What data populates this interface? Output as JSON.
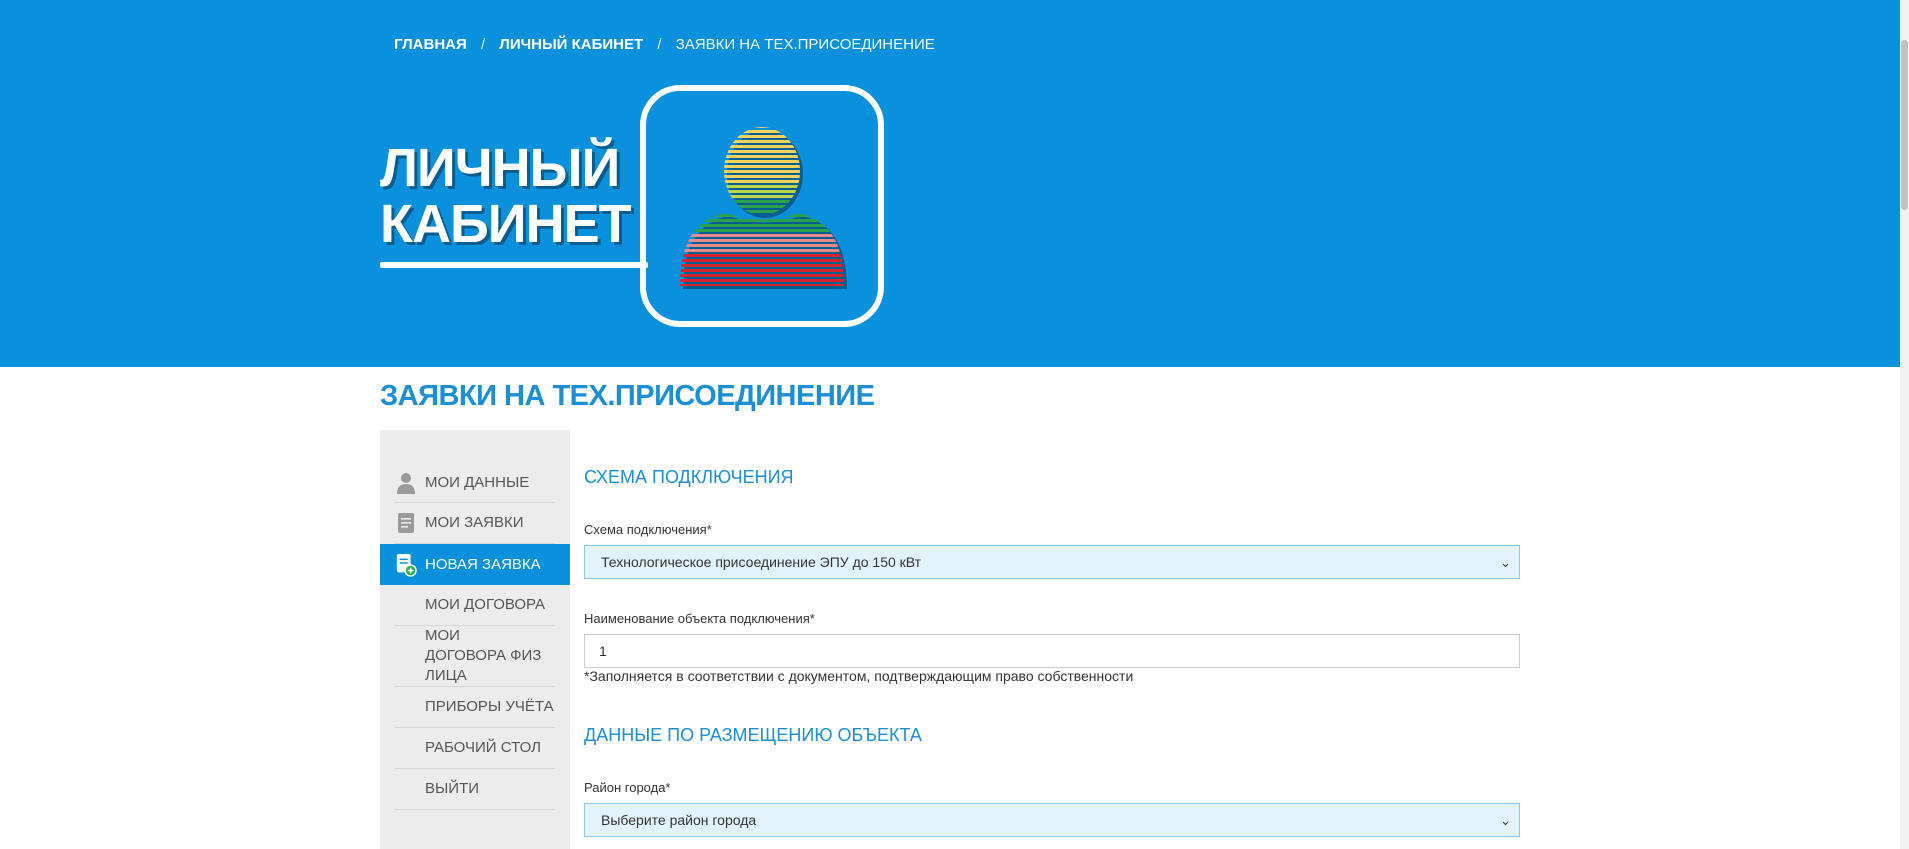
{
  "breadcrumb": {
    "home": "ГЛАВНАЯ",
    "cabinet": "ЛИЧНЫЙ КАБИНЕТ",
    "current": "ЗАЯВКИ НА ТЕХ.ПРИСОЕДИНЕНИЕ",
    "separator": "/"
  },
  "hero": {
    "title_line1": "ЛИЧНЫЙ",
    "title_line2": "КАБИНЕТ",
    "icon": "user-striped-icon"
  },
  "page_title": "ЗАЯВКИ НА ТЕХ.ПРИСОЕДИНЕНИЕ",
  "sidebar": {
    "items": [
      {
        "label": "МОИ ДАННЫЕ",
        "icon": "user-icon"
      },
      {
        "label": "МОИ ЗАЯВКИ",
        "icon": "document-icon"
      },
      {
        "label": "НОВАЯ ЗАЯВКА",
        "icon": "new-document-icon",
        "active": true
      },
      {
        "label": "МОИ ДОГОВОРА"
      },
      {
        "label": "МОИ ДОГОВОРА ФИЗ ЛИЦА"
      },
      {
        "label": "ПРИБОРЫ УЧЁТА"
      },
      {
        "label": "РАБОЧИЙ СТОЛ"
      },
      {
        "label": "ВЫЙТИ"
      }
    ]
  },
  "form": {
    "section1_title": "СХЕМА ПОДКЛЮЧЕНИЯ",
    "scheme_label": "Схема подключения*",
    "scheme_value": "Технологическое присоединение ЭПУ до 150 кВт",
    "object_label": "Наименование объекта подключения*",
    "object_value": "1",
    "object_hint": "*Заполняется в соответствии с документом, подтверждающим право собственности",
    "section2_title": "ДАННЫЕ ПО РАЗМЕЩЕНИЮ ОБЪЕКТА",
    "district_label": "Район города*",
    "district_placeholder": "Выберите район города"
  },
  "colors": {
    "brand_blue": "#0a91dd",
    "title_blue": "#1a8fd6",
    "select_bg": "#e3f3fc",
    "sidebar_bg": "#ececec"
  }
}
